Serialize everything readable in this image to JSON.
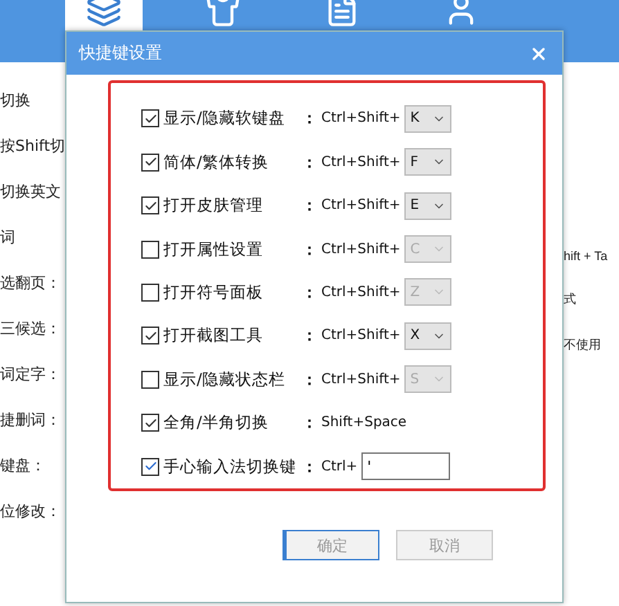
{
  "app": {
    "tabs": [
      {
        "selected": true
      },
      {
        "selected": false
      },
      {
        "selected": false
      },
      {
        "selected": false
      }
    ],
    "left_labels": [
      "切换",
      "按Shift切",
      "切换英文",
      "词",
      "选翻页：",
      "三候选：",
      "词定字：",
      "捷删词：",
      "键盘：",
      "位修改："
    ],
    "right_labels": [
      "hift + Ta",
      "式",
      "不使用"
    ]
  },
  "dialog": {
    "title": "快捷键设置",
    "rows": [
      {
        "kind": "select",
        "label": "显示/隐藏软键盘",
        "checked": true,
        "separator": "：",
        "prefix": "Ctrl+Shift+",
        "key": "K"
      },
      {
        "kind": "select",
        "label": "简体/繁体转换",
        "checked": true,
        "separator": "：",
        "prefix": "Ctrl+Shift+",
        "key": "F"
      },
      {
        "kind": "select",
        "label": "打开皮肤管理",
        "checked": true,
        "separator": "：",
        "prefix": "Ctrl+Shift+",
        "key": "E"
      },
      {
        "kind": "select",
        "label": "打开属性设置",
        "checked": false,
        "separator": "：",
        "prefix": "Ctrl+Shift+",
        "key": "C"
      },
      {
        "kind": "select",
        "label": "打开符号面板",
        "checked": false,
        "separator": "：",
        "prefix": "Ctrl+Shift+",
        "key": "Z"
      },
      {
        "kind": "select",
        "label": "打开截图工具",
        "checked": true,
        "separator": "：",
        "prefix": "Ctrl+Shift+",
        "key": "X"
      },
      {
        "kind": "select",
        "label": "显示/隐藏状态栏",
        "checked": false,
        "separator": "：",
        "prefix": "Ctrl+Shift+",
        "key": "S"
      },
      {
        "kind": "text",
        "label": "全角/半角切换",
        "checked": true,
        "separator": "：",
        "prefix": "Shift+Space"
      },
      {
        "kind": "input",
        "label": "手心输入法切换键",
        "checked": true,
        "separator": "：",
        "prefix": "Ctrl+",
        "value": "'"
      }
    ],
    "buttons": [
      {
        "label": "确定",
        "focused": true
      },
      {
        "label": "取消",
        "focused": false
      }
    ]
  }
}
